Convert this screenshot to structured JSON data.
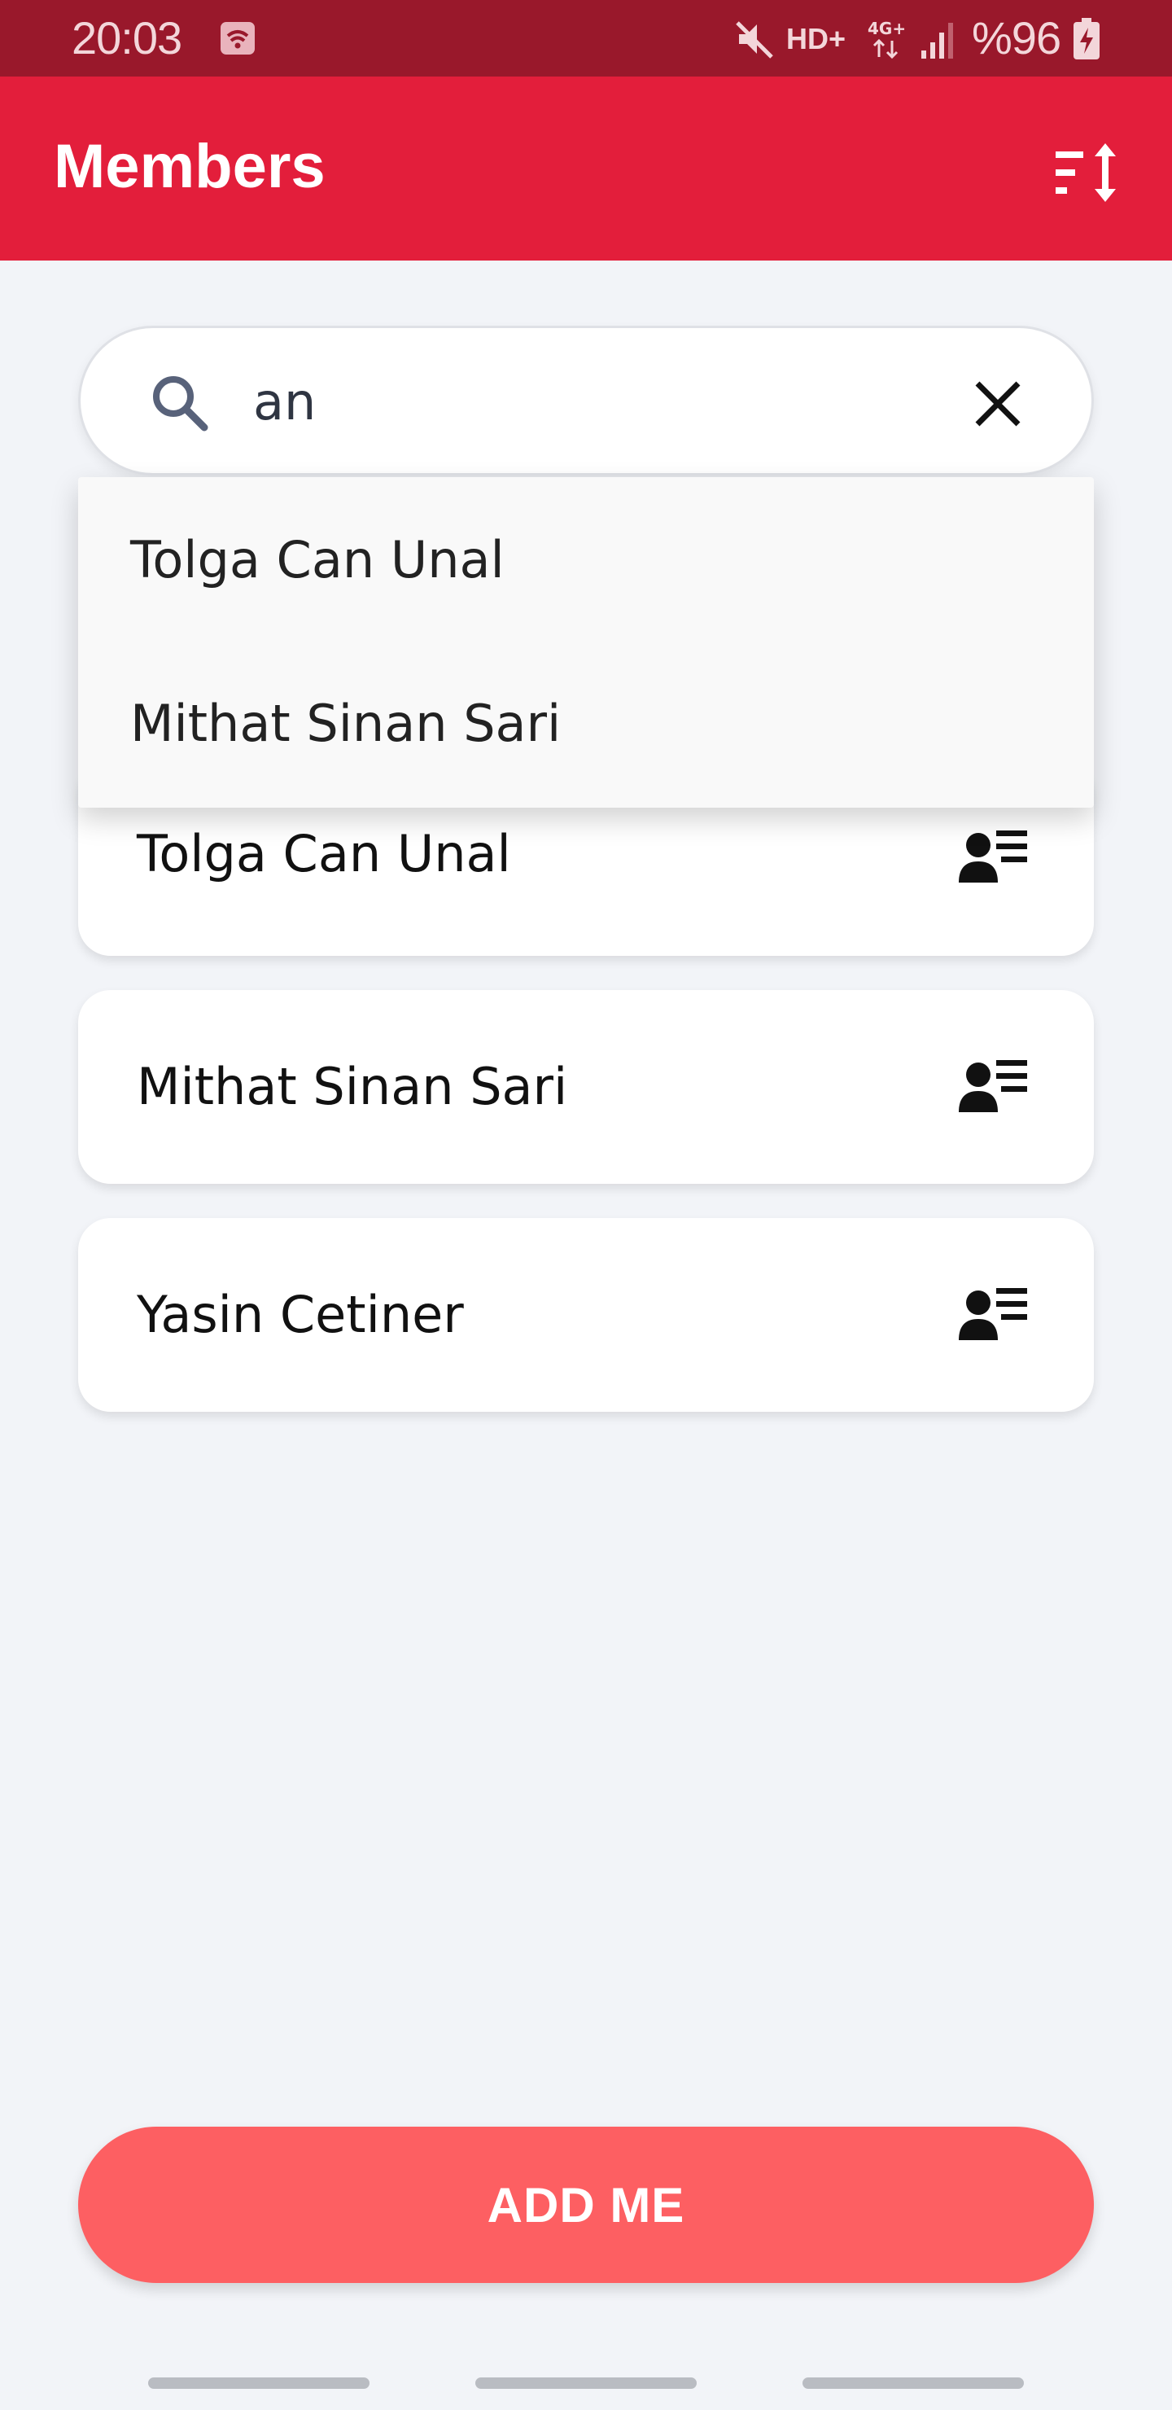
{
  "status_bar": {
    "time": "20:03",
    "network_label": "HD+",
    "battery_label": "%96",
    "icons": [
      "notification-icon",
      "mute-icon",
      "4g-data-icon",
      "signal-icon",
      "battery-charging-icon"
    ]
  },
  "app_bar": {
    "title": "Members",
    "sort_icon": "sort-icon"
  },
  "search": {
    "value": "an",
    "search_icon": "search-icon",
    "clear_icon": "close-icon"
  },
  "suggestions": [
    {
      "label": "Tolga Can Unal"
    },
    {
      "label": "Mithat Sinan Sari"
    }
  ],
  "members": [
    {
      "name": "Tolga Can Unal",
      "icon": "member-details-icon"
    },
    {
      "name": "Mithat Sinan Sari",
      "icon": "member-details-icon"
    },
    {
      "name": "Yasin Cetiner",
      "icon": "member-details-icon"
    }
  ],
  "actions": {
    "add_me_label": "ADD ME"
  },
  "colors": {
    "status_bar": "#99182b",
    "app_bar": "#e31e3b",
    "background": "#f2f4f8",
    "add_button": "#fd5f62"
  }
}
